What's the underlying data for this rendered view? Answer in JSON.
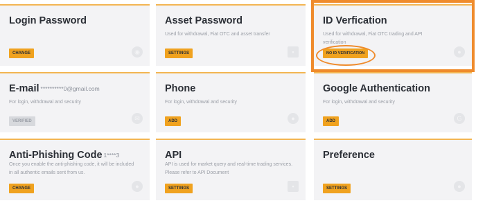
{
  "cards": [
    {
      "title": "Login Password",
      "suffix": "",
      "description": "",
      "button": "CHANGE",
      "icon": "eye-icon"
    },
    {
      "title": "Asset Password",
      "suffix": "",
      "description": "Used for withdrawal, Fiat OTC and asset transfer",
      "button": "SETTINGS",
      "icon": "key-icon"
    },
    {
      "title": "ID Verfication",
      "suffix": "",
      "description": "Used for withdrawal, Fiat OTC trading and API verification",
      "button": "NO ID VERIFICATION",
      "icon": "id-icon"
    },
    {
      "title": "E-mail",
      "suffix": "**********0@gmail.com",
      "description": "For login, withdrawal and security",
      "button": "VERIFIED",
      "icon": "mail-icon"
    },
    {
      "title": "Phone",
      "suffix": "",
      "description": "For login, withdrawal and security",
      "button": "ADD",
      "icon": "phone-icon"
    },
    {
      "title": "Google Authentication",
      "suffix": "",
      "description": "For login, withdrawal and security",
      "button": "ADD",
      "icon": "google-icon"
    },
    {
      "title": "Anti-Phishing Code",
      "suffix": "1****3",
      "description": "Once you enable the anti-phishing code, it will be included in all authentic emails sent from us.",
      "button": "CHANGE",
      "icon": "shield-icon"
    },
    {
      "title": "API",
      "suffix": "",
      "description": "API is used for market query and real-time trading services. Please refer to API Document",
      "button": "SETTINGS",
      "icon": "api-icon"
    },
    {
      "title": "Preference",
      "suffix": "",
      "description": "",
      "button": "SETTINGS",
      "icon": "settings-icon"
    }
  ],
  "colors": {
    "accent": "#f0a21f",
    "highlight": "#ef8b2c",
    "card_bg": "#f3f3f5"
  }
}
